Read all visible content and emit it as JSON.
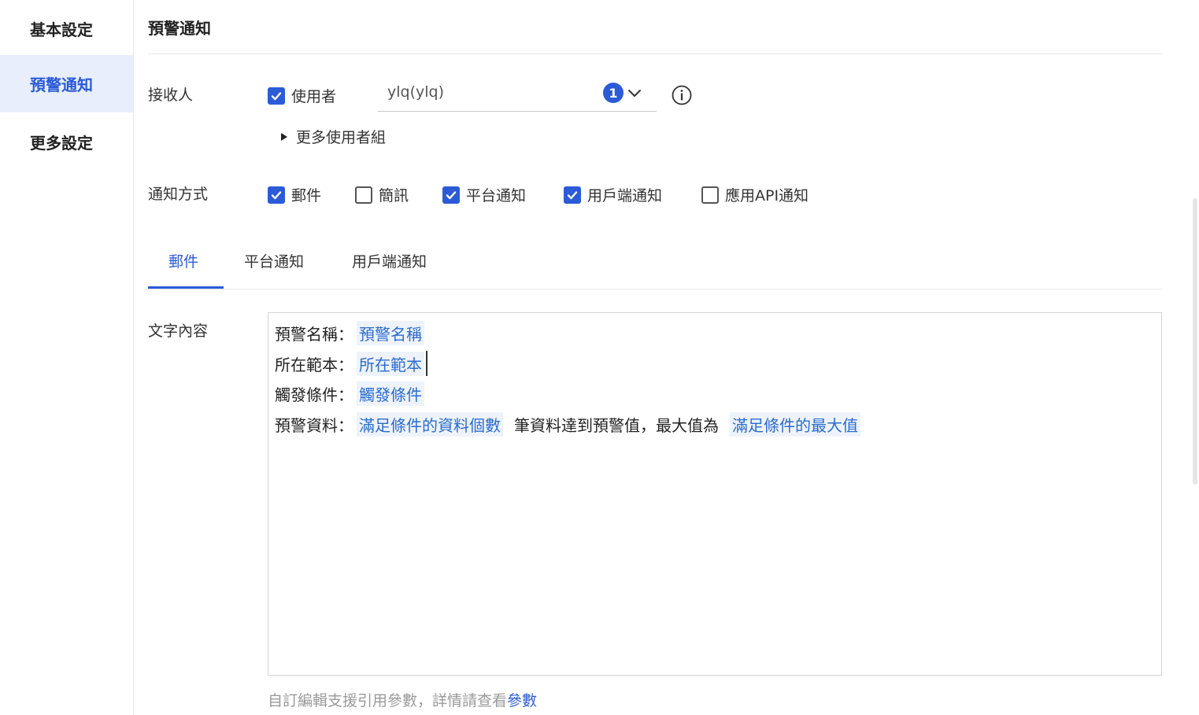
{
  "sidebar": {
    "items": [
      {
        "label": "基本設定",
        "active": false
      },
      {
        "label": "預警通知",
        "active": true
      },
      {
        "label": "更多設定",
        "active": false
      }
    ]
  },
  "section": {
    "title": "預警通知"
  },
  "recipients": {
    "label": "接收人",
    "user_checkbox": {
      "label": "使用者",
      "checked": true
    },
    "select_value": "ylq(ylq)",
    "count": "1",
    "more_groups_label": "更多使用者組"
  },
  "methods": {
    "label": "通知方式",
    "options": [
      {
        "label": "郵件",
        "checked": true
      },
      {
        "label": "簡訊",
        "checked": false
      },
      {
        "label": "平台通知",
        "checked": true
      },
      {
        "label": "用戶端通知",
        "checked": true
      },
      {
        "label": "應用API通知",
        "checked": false
      }
    ]
  },
  "tabs": [
    {
      "label": "郵件",
      "active": true
    },
    {
      "label": "平台通知",
      "active": false
    },
    {
      "label": "用戶端通知",
      "active": false
    }
  ],
  "content": {
    "label": "文字內容",
    "lines": [
      {
        "prefix": "預警名稱：",
        "tag": "預警名稱"
      },
      {
        "prefix": "所在範本：",
        "tag": "所在範本"
      },
      {
        "prefix": "觸發條件：",
        "tag": "觸發條件"
      },
      {
        "prefix": "預警資料：",
        "tag": "滿足條件的資料個數",
        "middle": "筆資料達到預警值，最大值為",
        "tag2": "滿足條件的最大值"
      }
    ]
  },
  "hint": {
    "text": "自訂編輯支援引用參數，詳情請查看",
    "link": "參數"
  },
  "colors": {
    "accent": "#2b5bd7",
    "active_bg": "#e8eefb",
    "tag_text": "#2b6ccf",
    "tag_bg": "#eef3fb"
  }
}
